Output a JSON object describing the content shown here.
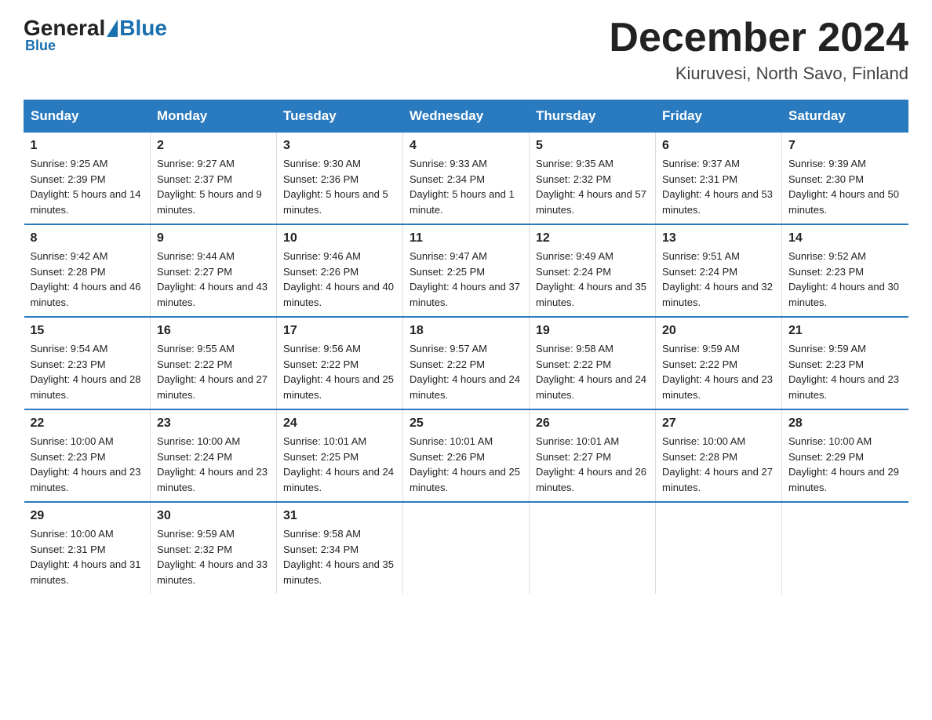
{
  "header": {
    "logo_general": "General",
    "logo_blue": "Blue",
    "month_title": "December 2024",
    "subtitle": "Kiuruvesi, North Savo, Finland"
  },
  "days_of_week": [
    "Sunday",
    "Monday",
    "Tuesday",
    "Wednesday",
    "Thursday",
    "Friday",
    "Saturday"
  ],
  "weeks": [
    [
      {
        "day": "1",
        "sunrise": "9:25 AM",
        "sunset": "2:39 PM",
        "daylight": "5 hours and 14 minutes."
      },
      {
        "day": "2",
        "sunrise": "9:27 AM",
        "sunset": "2:37 PM",
        "daylight": "5 hours and 9 minutes."
      },
      {
        "day": "3",
        "sunrise": "9:30 AM",
        "sunset": "2:36 PM",
        "daylight": "5 hours and 5 minutes."
      },
      {
        "day": "4",
        "sunrise": "9:33 AM",
        "sunset": "2:34 PM",
        "daylight": "5 hours and 1 minute."
      },
      {
        "day": "5",
        "sunrise": "9:35 AM",
        "sunset": "2:32 PM",
        "daylight": "4 hours and 57 minutes."
      },
      {
        "day": "6",
        "sunrise": "9:37 AM",
        "sunset": "2:31 PM",
        "daylight": "4 hours and 53 minutes."
      },
      {
        "day": "7",
        "sunrise": "9:39 AM",
        "sunset": "2:30 PM",
        "daylight": "4 hours and 50 minutes."
      }
    ],
    [
      {
        "day": "8",
        "sunrise": "9:42 AM",
        "sunset": "2:28 PM",
        "daylight": "4 hours and 46 minutes."
      },
      {
        "day": "9",
        "sunrise": "9:44 AM",
        "sunset": "2:27 PM",
        "daylight": "4 hours and 43 minutes."
      },
      {
        "day": "10",
        "sunrise": "9:46 AM",
        "sunset": "2:26 PM",
        "daylight": "4 hours and 40 minutes."
      },
      {
        "day": "11",
        "sunrise": "9:47 AM",
        "sunset": "2:25 PM",
        "daylight": "4 hours and 37 minutes."
      },
      {
        "day": "12",
        "sunrise": "9:49 AM",
        "sunset": "2:24 PM",
        "daylight": "4 hours and 35 minutes."
      },
      {
        "day": "13",
        "sunrise": "9:51 AM",
        "sunset": "2:24 PM",
        "daylight": "4 hours and 32 minutes."
      },
      {
        "day": "14",
        "sunrise": "9:52 AM",
        "sunset": "2:23 PM",
        "daylight": "4 hours and 30 minutes."
      }
    ],
    [
      {
        "day": "15",
        "sunrise": "9:54 AM",
        "sunset": "2:23 PM",
        "daylight": "4 hours and 28 minutes."
      },
      {
        "day": "16",
        "sunrise": "9:55 AM",
        "sunset": "2:22 PM",
        "daylight": "4 hours and 27 minutes."
      },
      {
        "day": "17",
        "sunrise": "9:56 AM",
        "sunset": "2:22 PM",
        "daylight": "4 hours and 25 minutes."
      },
      {
        "day": "18",
        "sunrise": "9:57 AM",
        "sunset": "2:22 PM",
        "daylight": "4 hours and 24 minutes."
      },
      {
        "day": "19",
        "sunrise": "9:58 AM",
        "sunset": "2:22 PM",
        "daylight": "4 hours and 24 minutes."
      },
      {
        "day": "20",
        "sunrise": "9:59 AM",
        "sunset": "2:22 PM",
        "daylight": "4 hours and 23 minutes."
      },
      {
        "day": "21",
        "sunrise": "9:59 AM",
        "sunset": "2:23 PM",
        "daylight": "4 hours and 23 minutes."
      }
    ],
    [
      {
        "day": "22",
        "sunrise": "10:00 AM",
        "sunset": "2:23 PM",
        "daylight": "4 hours and 23 minutes."
      },
      {
        "day": "23",
        "sunrise": "10:00 AM",
        "sunset": "2:24 PM",
        "daylight": "4 hours and 23 minutes."
      },
      {
        "day": "24",
        "sunrise": "10:01 AM",
        "sunset": "2:25 PM",
        "daylight": "4 hours and 24 minutes."
      },
      {
        "day": "25",
        "sunrise": "10:01 AM",
        "sunset": "2:26 PM",
        "daylight": "4 hours and 25 minutes."
      },
      {
        "day": "26",
        "sunrise": "10:01 AM",
        "sunset": "2:27 PM",
        "daylight": "4 hours and 26 minutes."
      },
      {
        "day": "27",
        "sunrise": "10:00 AM",
        "sunset": "2:28 PM",
        "daylight": "4 hours and 27 minutes."
      },
      {
        "day": "28",
        "sunrise": "10:00 AM",
        "sunset": "2:29 PM",
        "daylight": "4 hours and 29 minutes."
      }
    ],
    [
      {
        "day": "29",
        "sunrise": "10:00 AM",
        "sunset": "2:31 PM",
        "daylight": "4 hours and 31 minutes."
      },
      {
        "day": "30",
        "sunrise": "9:59 AM",
        "sunset": "2:32 PM",
        "daylight": "4 hours and 33 minutes."
      },
      {
        "day": "31",
        "sunrise": "9:58 AM",
        "sunset": "2:34 PM",
        "daylight": "4 hours and 35 minutes."
      },
      null,
      null,
      null,
      null
    ]
  ]
}
